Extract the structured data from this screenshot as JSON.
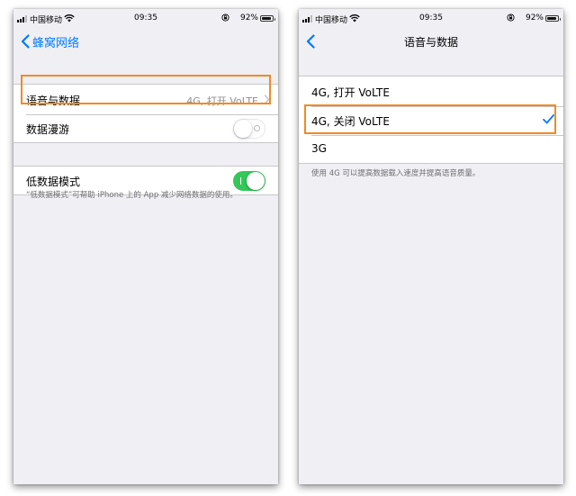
{
  "status_bar": {
    "carrier": "中国移动",
    "time": "09:35",
    "battery": "92%",
    "battery_level": 0.92
  },
  "left_screen": {
    "back_label": "蜂窝网络",
    "items": [
      {
        "label": "语音与数据",
        "value": "4G, 打开 VoLTE"
      },
      {
        "label": "数据漫游",
        "toggle": false
      },
      {
        "label": "低数据模式",
        "toggle": true
      }
    ],
    "footer": "“低数据模式”可帮助 iPhone 上的 App 减少网络数据的使用。"
  },
  "right_screen": {
    "title": "语音与数据",
    "options": [
      {
        "label": "4G, 打开 VoLTE",
        "selected": false
      },
      {
        "label": "4G, 关闭 VoLTE",
        "selected": true
      },
      {
        "label": "3G",
        "selected": false
      }
    ],
    "footer": "使用 4G 可以提高数据载入速度并提高语音质量。"
  },
  "colors": {
    "accent": "#007aff",
    "toggle_on": "#34c759",
    "highlight": "#f28a21",
    "background": "#efeff4"
  },
  "icons": [
    "signal-icon",
    "wifi-icon",
    "orientation-lock-icon",
    "battery-icon",
    "back-chevron-icon",
    "disclosure-chevron-icon",
    "checkmark-icon"
  ]
}
